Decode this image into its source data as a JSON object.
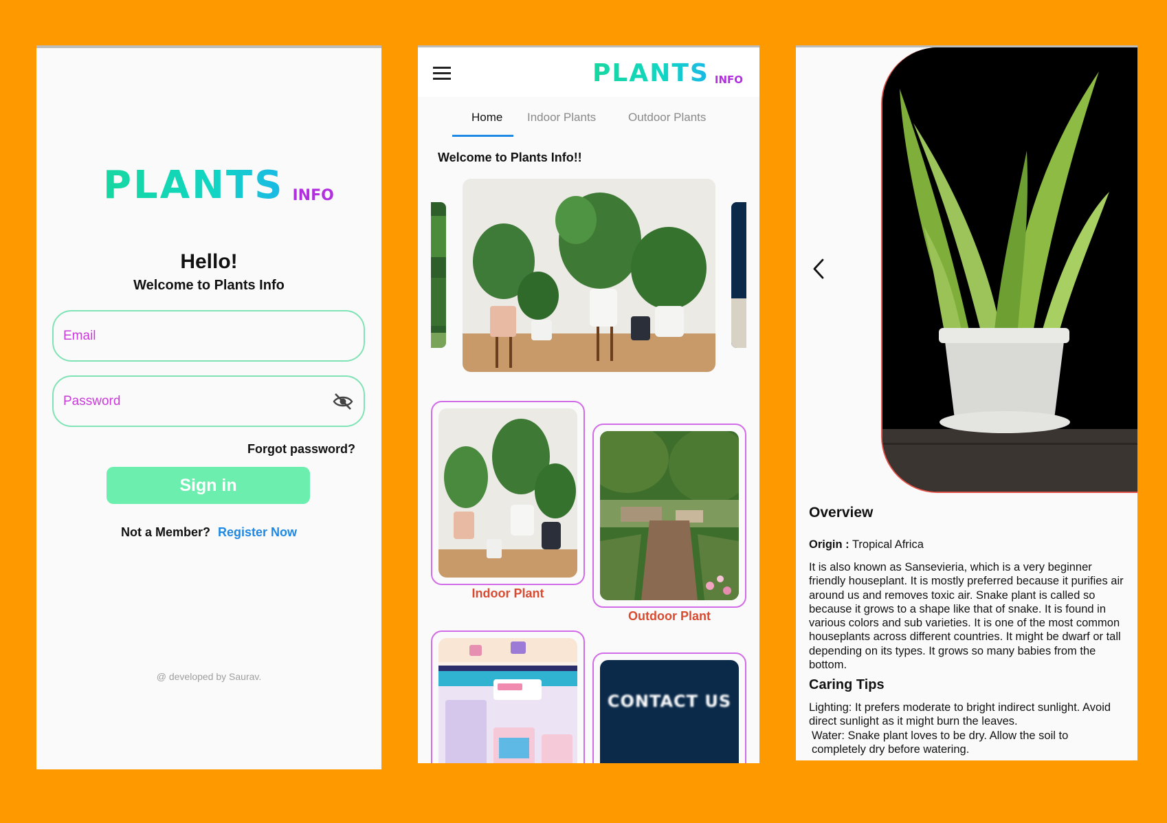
{
  "brand": {
    "name": "PLANTS",
    "suffix": "INFO"
  },
  "login": {
    "greeting": "Hello!",
    "subtitle": "Welcome to Plants Info",
    "email_placeholder": "Email",
    "password_placeholder": "Password",
    "forgot_label": "Forgot password?",
    "signin_label": "Sign in",
    "member_prompt": "Not a Member?",
    "register_label": "Register Now",
    "footer": "@ developed by Saurav."
  },
  "home": {
    "tabs": [
      {
        "label": "Home",
        "active": true
      },
      {
        "label": "Indoor Plants",
        "active": false
      },
      {
        "label": "Outdoor Plants",
        "active": false
      }
    ],
    "welcome": "Welcome to Plants Info!!",
    "cards": [
      {
        "label": "Indoor Plant"
      },
      {
        "label": "Outdoor Plant"
      },
      {
        "label": ""
      },
      {
        "label": "",
        "image_text": "CONTACT US"
      }
    ]
  },
  "detail": {
    "overview_heading": "Overview",
    "origin_label": "Origin :",
    "origin_value": "Tropical Africa",
    "description": "It is also known as Sansevieria, which is a very beginner friendly houseplant. It is mostly preferred because it purifies air around us and removes toxic air. Snake plant is called so because it grows to a shape like that of snake. It is found in various colors and sub varieties. It is one of the most common houseplants across different countries. It might be dwarf or tall depending on its types. It grows so many babies from the bottom.",
    "caring_heading": "Caring Tips",
    "lighting": "Lighting: It prefers moderate to bright indirect sunlight. Avoid direct sunlight as it might burn the leaves.",
    "water": "Water: Snake plant loves to be dry. Allow the soil to completely dry before watering."
  },
  "colors": {
    "background": "#FF9900",
    "accent_green": "#6CEFAE",
    "field_border": "#7FE3B5",
    "placeholder": "#C83BD8",
    "link": "#1E88E5",
    "card_border": "#D26BE8",
    "card_label": "#D84B31"
  },
  "icons": [
    "eye-off-icon",
    "menu-icon",
    "back-arrow-icon"
  ]
}
